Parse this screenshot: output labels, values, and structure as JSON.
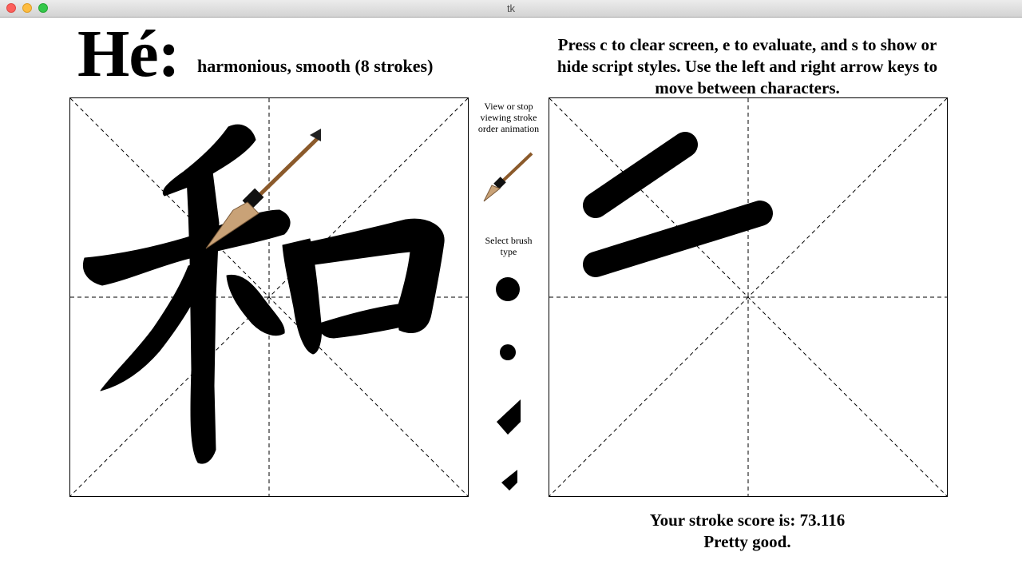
{
  "window": {
    "title": "tk"
  },
  "character": {
    "pinyin": "Hé:",
    "meaning": "harmonious, smooth (8 strokes)"
  },
  "instructions": "Press c to clear screen, e to evaluate, and s to show or hide script styles. Use the left and right arrow keys to move between characters.",
  "sidebar": {
    "animation_label": "View or stop viewing stroke order animation",
    "brush_label": "Select brush type",
    "brush_icons": [
      "brush-icon",
      "round-large-brush-icon",
      "round-small-brush-icon",
      "flat-large-brush-icon",
      "flat-small-brush-icon"
    ]
  },
  "score": {
    "line1": "Your stroke score is: 73.116",
    "line2": "Pretty good."
  }
}
